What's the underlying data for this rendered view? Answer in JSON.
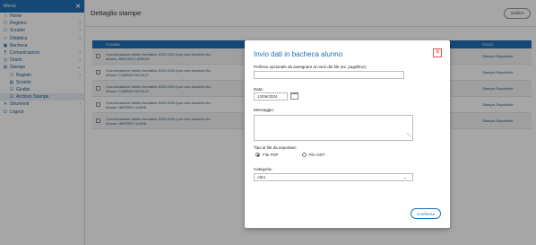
{
  "sidebar": {
    "title": "Menù",
    "items": [
      {
        "icon": "○",
        "label": "Home",
        "arrow": ""
      },
      {
        "icon": "☐",
        "label": "Registro",
        "arrow": "›"
      },
      {
        "icon": "☐",
        "label": "Scrutini",
        "arrow": "›"
      },
      {
        "icon": "□",
        "label": "Didattica",
        "arrow": "›"
      },
      {
        "icon": "▣",
        "label": "Bacheca",
        "arrow": ""
      },
      {
        "icon": "¶",
        "label": "Comunicazioni",
        "arrow": "›"
      },
      {
        "icon": "◷",
        "label": "Orario",
        "arrow": "›"
      },
      {
        "icon": "▤",
        "label": "Stampe",
        "arrow": "⌄"
      }
    ],
    "stampe_sub": [
      {
        "icon": "☐",
        "label": "Registri",
        "arrow": "›"
      },
      {
        "icon": "▤",
        "label": "Scrutini",
        "arrow": ""
      },
      {
        "icon": "☑",
        "label": "Giudizi",
        "arrow": ""
      },
      {
        "icon": "☑",
        "label": "Archivio Stampe",
        "arrow": ""
      }
    ],
    "bottom": [
      {
        "icon": "✕",
        "label": "Strumenti",
        "arrow": "›"
      },
      {
        "icon": "⏻",
        "label": "Logout",
        "arrow": ""
      }
    ]
  },
  "header": {
    "title": "Dettaglio stampe",
    "back_label": "Indietro"
  },
  "table": {
    "headers": {
      "stampa": "STAMPA",
      "stato": "STATO"
    },
    "rows": [
      {
        "line1": "Comunicazione debito formativo 2023 2024 (con voto scrutinio fin...",
        "line2": "Alunno: BRIGNOLI ARIELE",
        "stato": "Stampa Disponibile"
      },
      {
        "line1": "Comunicazione debito formativo 2023 2024 (con voto scrutinio fin...",
        "line2": "Alunno: CABRINI NICOLO'",
        "stato": "Stampa Disponibile"
      },
      {
        "line1": "Comunicazione debito formativo 2023 2024 (con voto scrutinio fin...",
        "line2": "Alunno: CABRINI NICOLO'",
        "stato": "Stampa Disponibile"
      },
      {
        "line1": "Comunicazione debito formativo 2023 2024 (con voto scrutinio fin...",
        "line2": "Alunno: IMPERIO ILARIA",
        "stato": "Stampa Disponibile"
      },
      {
        "line1": "Comunicazione debito formativo 2023 2024 (con voto scrutinio fin...",
        "line2": "Alunno: IMPERIO ILARIA",
        "stato": "Stampa Disponibile"
      }
    ]
  },
  "modal": {
    "title": "Invio dati in bacheca alunno",
    "prefix_label": "Prefisso opzionale da assegnare ai nomi dei file (es. pagellino):",
    "prefix_value": "",
    "date_label": "Data:",
    "date_value": "13/06/2024",
    "message_label": "Messaggio:",
    "file_type_label": "Tipo di file da esportare:",
    "pdf_label": "File PDF",
    "odt_label": "File ODT",
    "category_label": "Categoria:",
    "category_value": "Altro",
    "confirm_label": "Conferma"
  }
}
